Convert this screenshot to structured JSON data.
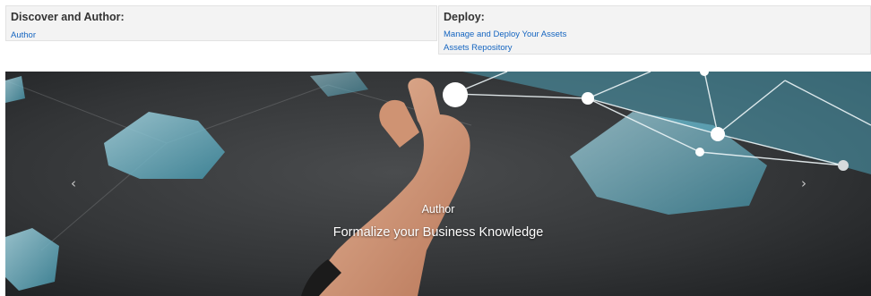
{
  "discover": {
    "title": "Discover and Author:",
    "links": [
      "Author"
    ]
  },
  "deploy": {
    "title": "Deploy:",
    "links": [
      "Manage and Deploy Your Assets",
      "Assets Repository"
    ]
  },
  "carousel": {
    "prev_icon": "chevron-left-icon",
    "next_icon": "chevron-right-icon",
    "prev_glyph": "‹",
    "next_glyph": "›",
    "slide_title": "Author",
    "slide_subtitle": "Formalize your Business Knowledge"
  }
}
